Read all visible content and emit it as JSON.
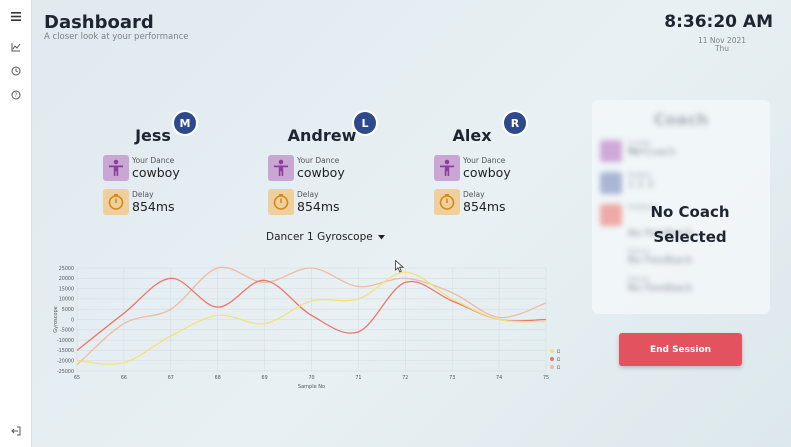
{
  "header": {
    "title": "Dashboard",
    "subtitle": "A closer look at your performance",
    "time": "8:36:20 AM",
    "date": "11 Nov 2021",
    "day": "Thu"
  },
  "sidebar": {
    "items": [
      {
        "icon": "menu-icon"
      },
      {
        "icon": "chart-icon"
      },
      {
        "icon": "clock-icon"
      },
      {
        "icon": "help-icon"
      },
      {
        "icon": "logout-icon"
      }
    ]
  },
  "dancers": [
    {
      "name": "Jess",
      "position": "M",
      "dance_label": "Your Dance",
      "dance": "cowboy",
      "delay_label": "Delay",
      "delay": "854ms"
    },
    {
      "name": "Andrew",
      "position": "L",
      "dance_label": "Your Dance",
      "dance": "cowboy",
      "delay_label": "Delay",
      "delay": "854ms"
    },
    {
      "name": "Alex",
      "position": "R",
      "dance_label": "Your Dance",
      "dance": "cowboy",
      "delay_label": "Delay",
      "delay": "854ms"
    }
  ],
  "gyroscope_dropdown": {
    "label": "Dancer 1 Gyroscope"
  },
  "coach": {
    "title": "Coach",
    "rows": [
      {
        "label": "Current Dance",
        "value": "No Coach"
      },
      {
        "label": "Position",
        "value": "1 2 3"
      },
      {
        "label": "Feedback",
        "value": "No Feedback"
      },
      {
        "label": "Dancer 2",
        "value": "No Feedback"
      },
      {
        "label": "Dancer 3",
        "value": "No Feedback"
      }
    ],
    "empty_message_line1": "No Coach",
    "empty_message_line2": "Selected"
  },
  "end_session_label": "End Session",
  "colors": {
    "accent_red": "#e2525f",
    "badge_blue": "#2e4a8c",
    "dance_icon_bg": "#c9a6d3",
    "dance_icon_fg": "#8a3f9c",
    "delay_icon_bg": "#efd09c",
    "delay_icon_fg": "#d08a17"
  },
  "chart_data": {
    "type": "line",
    "xlabel": "Sample No",
    "ylabel": "Gyroscope",
    "x": [
      65,
      66,
      67,
      68,
      69,
      70,
      71,
      72,
      73,
      74,
      75
    ],
    "xlim": [
      65,
      75
    ],
    "ylim": [
      -25000,
      25000
    ],
    "yticks": [
      25000,
      20000,
      15000,
      10000,
      5000,
      0,
      -5000,
      -10000,
      -15000,
      -20000,
      -25000
    ],
    "legend_position": "bottom-right",
    "series": [
      {
        "name": "D1 GyroZ",
        "color": "#f2e27a",
        "values": [
          -20000,
          -21000,
          -8000,
          2000,
          -2000,
          9000,
          10000,
          23000,
          10000,
          0,
          -1000
        ]
      },
      {
        "name": "D1 GyroY",
        "color": "#e8786c",
        "values": [
          -15000,
          3000,
          20000,
          6000,
          19000,
          2000,
          -6000,
          18000,
          9000,
          0,
          0
        ]
      },
      {
        "name": "D1 GyroX",
        "color": "#eebba3",
        "values": [
          -22000,
          -2000,
          5000,
          25000,
          18000,
          25000,
          16000,
          20000,
          13000,
          1000,
          8000
        ]
      }
    ]
  }
}
